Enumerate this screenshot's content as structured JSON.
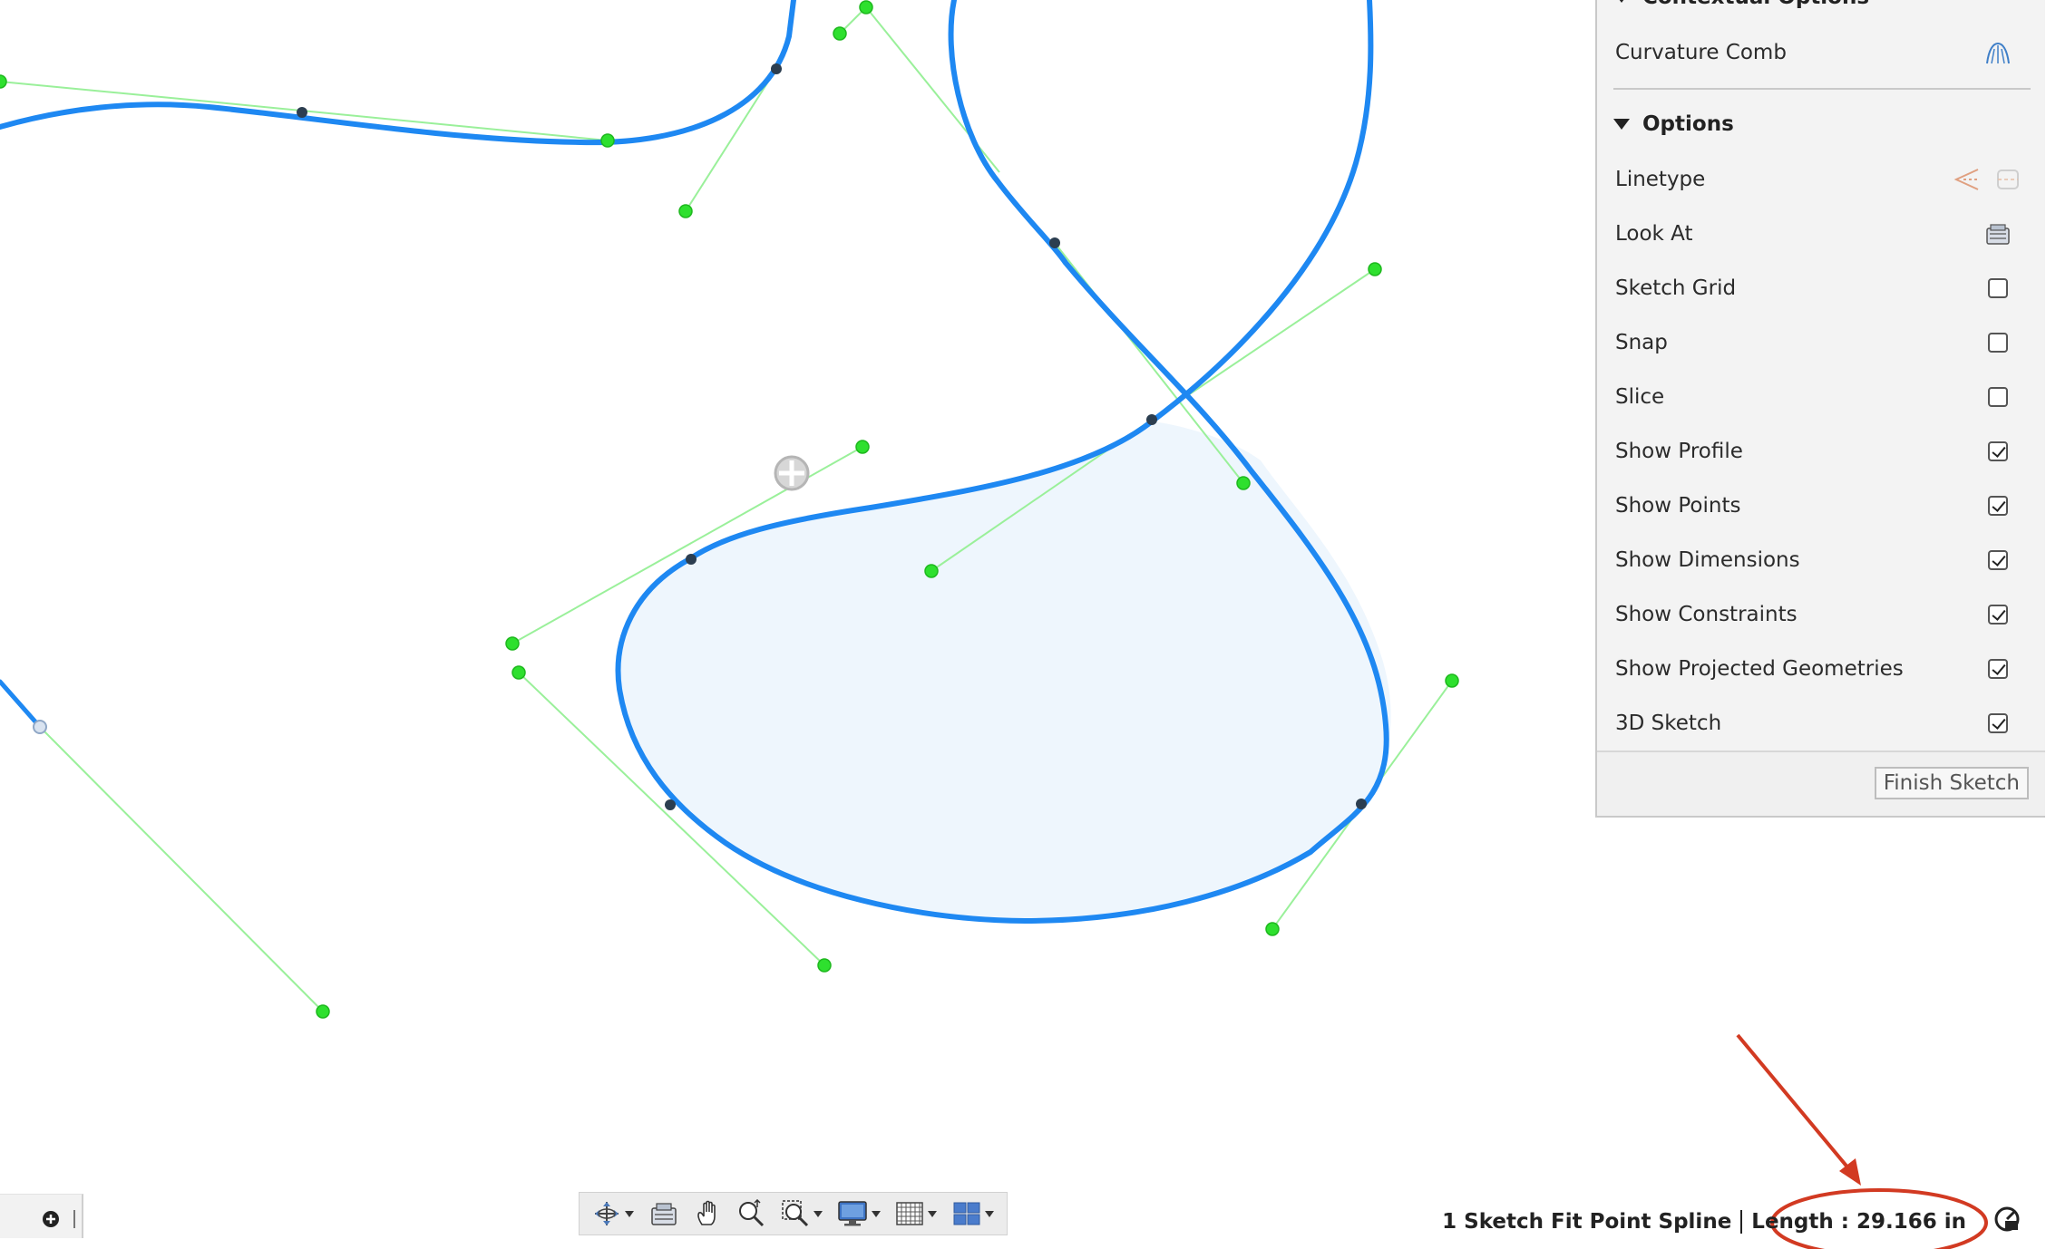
{
  "palette": {
    "contextual_header": "Contextual Options",
    "curvature_comb_label": "Curvature Comb",
    "curvature_comb_icon": "curvature-comb-icon",
    "options_header": "Options",
    "rows": [
      {
        "label": "Linetype",
        "control": "icons"
      },
      {
        "label": "Look At",
        "control": "icon"
      },
      {
        "label": "Sketch Grid",
        "checked": false
      },
      {
        "label": "Snap",
        "checked": false
      },
      {
        "label": "Slice",
        "checked": false
      },
      {
        "label": "Show Profile",
        "checked": true
      },
      {
        "label": "Show Points",
        "checked": true
      },
      {
        "label": "Show Dimensions",
        "checked": true
      },
      {
        "label": "Show Constraints",
        "checked": true
      },
      {
        "label": "Show Projected Geometries",
        "checked": true
      },
      {
        "label": "3D Sketch",
        "checked": true
      }
    ],
    "finish_button": "Finish Sketch"
  },
  "status": {
    "selection": "1 Sketch Fit Point Spline",
    "length": "Length : 29.166 in"
  },
  "navbar": {
    "tools": [
      "orbit-icon",
      "look-at-icon",
      "pan-hand-icon",
      "zoom-icon",
      "zoom-window-icon",
      "display-settings-icon",
      "grid-icon",
      "viewports-icon"
    ]
  },
  "colors": {
    "spline": "#1e88f2",
    "handle": "#2ee02e",
    "handle_line": "#9af09a",
    "profile_fill": "#eef6fd",
    "annotation": "#d23a22"
  }
}
